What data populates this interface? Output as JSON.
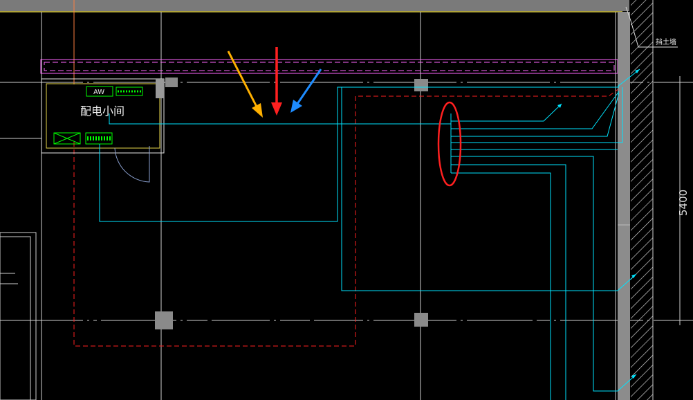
{
  "room": {
    "name": "配电小间",
    "panel_label": "AW"
  },
  "labels": {
    "retaining_wall": "挡土墙",
    "dimension": "5400"
  },
  "colors": {
    "background": "#000000",
    "grid": "#c8c8c8",
    "cable": "#00ffff",
    "boundary": "#ff2020",
    "duct": "#ff66ff",
    "room_wall": "#ffffff",
    "panel": "#00ff00",
    "column": "#808080",
    "wall": "#8c8c8c",
    "arrow_orange": "#ffb000",
    "arrow_red": "#ff2020",
    "arrow_blue": "#1e8cff",
    "highlight": "#ff2020"
  }
}
